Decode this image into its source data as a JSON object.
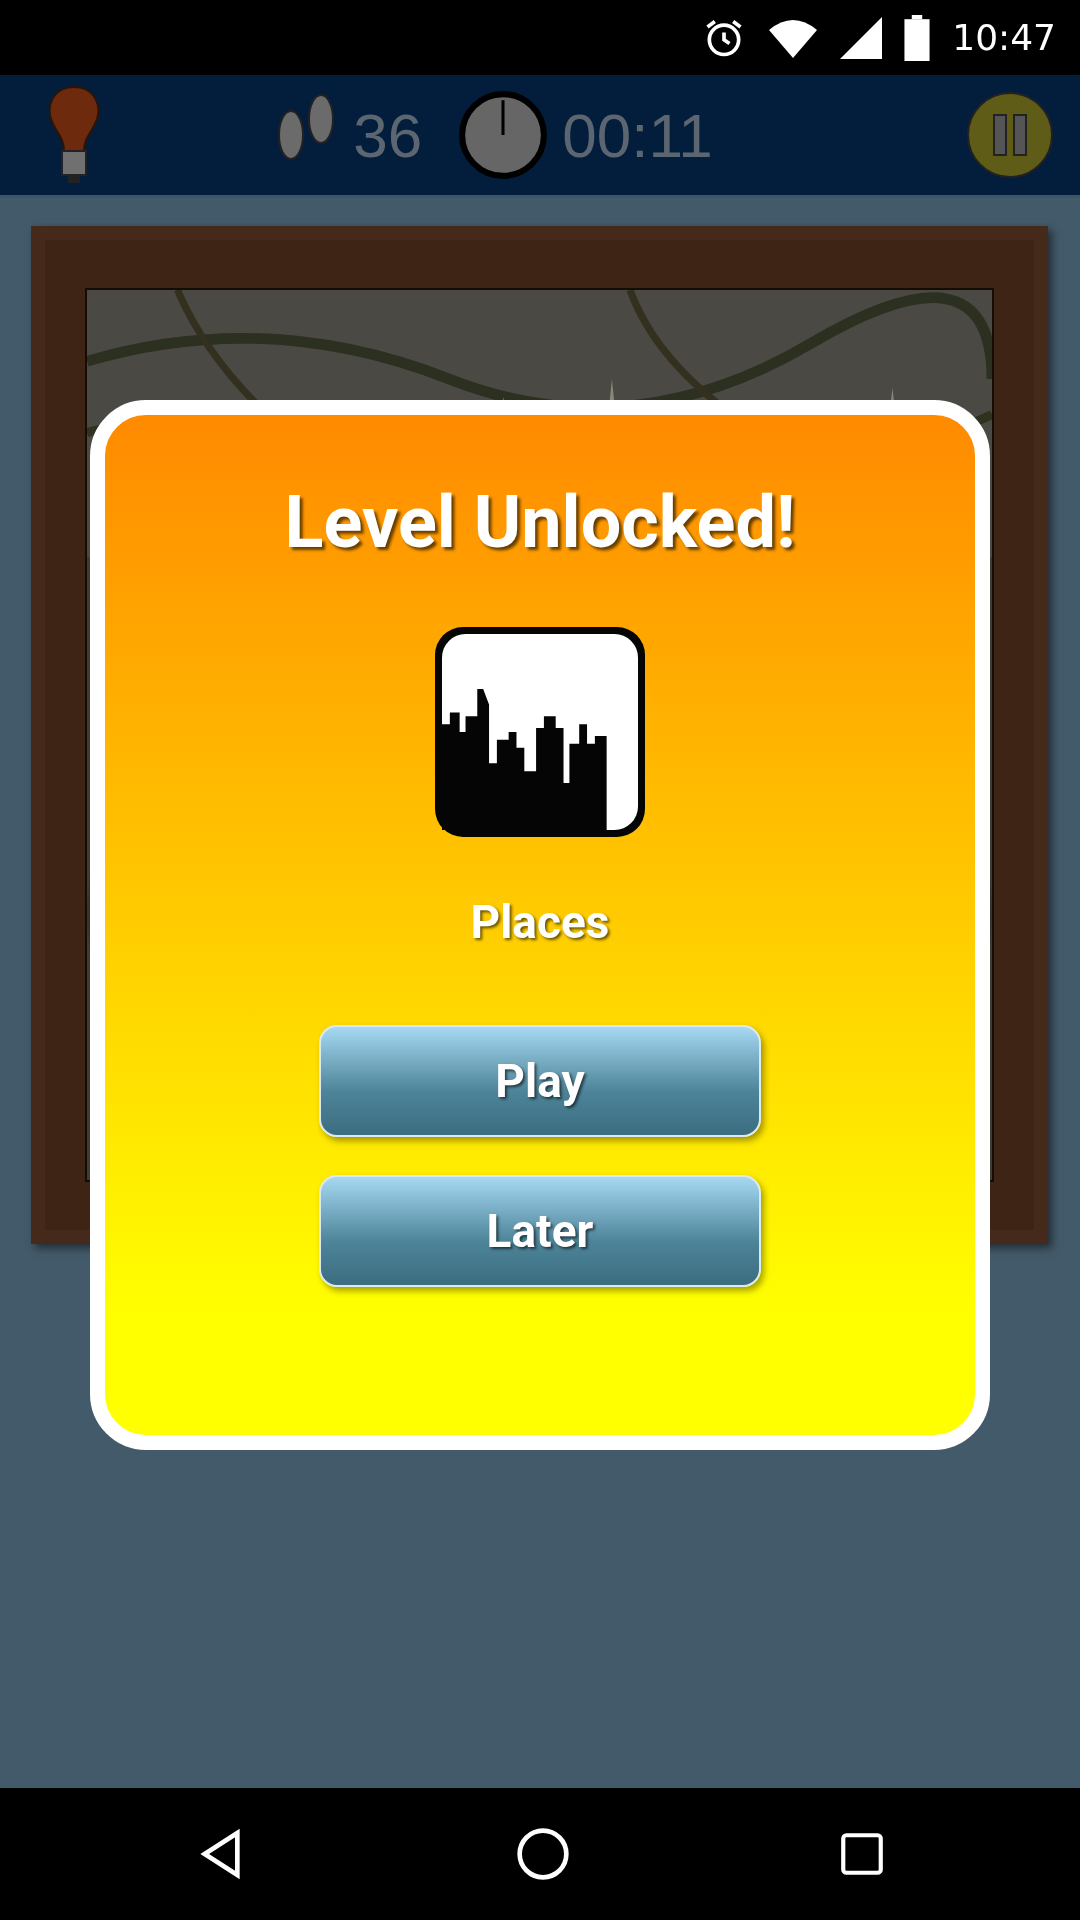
{
  "status_bar": {
    "time": "10:47"
  },
  "top_bar": {
    "moves": "36",
    "timer": "00:11"
  },
  "dialog": {
    "title": "Level Unlocked!",
    "category": "Places",
    "buttons": [
      {
        "label": "Play"
      },
      {
        "label": "Later"
      }
    ]
  }
}
